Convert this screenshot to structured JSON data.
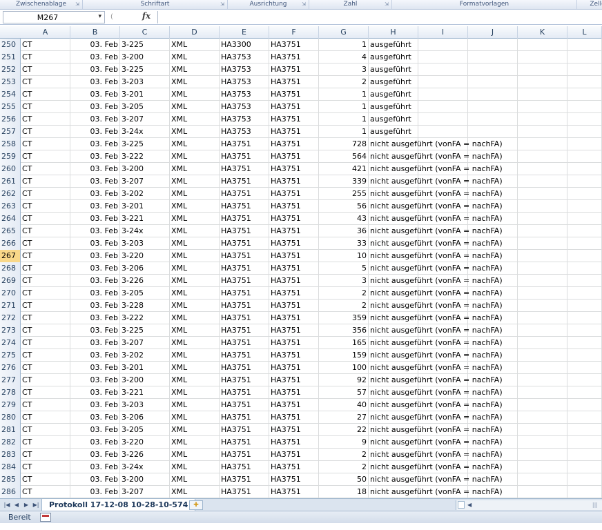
{
  "ribbon_groups": [
    {
      "label": "Zwischenablage",
      "launcher": true
    },
    {
      "label": "Schriftart",
      "launcher": true
    },
    {
      "label": "Ausrichtung",
      "launcher": true
    },
    {
      "label": "Zahl",
      "launcher": true
    },
    {
      "label": "Formatvorlagen",
      "launcher": false
    },
    {
      "label": "Zelle",
      "launcher": false
    }
  ],
  "formula_bar": {
    "name_box": "M267",
    "fx_label": "fx",
    "formula_value": ""
  },
  "columns": [
    "A",
    "B",
    "C",
    "D",
    "E",
    "F",
    "G",
    "H",
    "I",
    "J",
    "K",
    "L"
  ],
  "active_row": "267",
  "rows": [
    [
      "250",
      "CT",
      "03. Feb",
      "3-225",
      "XML",
      "HA3300",
      "HA3751",
      "1",
      "ausgeführt"
    ],
    [
      "251",
      "CT",
      "03. Feb",
      "3-200",
      "XML",
      "HA3753",
      "HA3751",
      "4",
      "ausgeführt"
    ],
    [
      "252",
      "CT",
      "03. Feb",
      "3-225",
      "XML",
      "HA3753",
      "HA3751",
      "3",
      "ausgeführt"
    ],
    [
      "253",
      "CT",
      "03. Feb",
      "3-203",
      "XML",
      "HA3753",
      "HA3751",
      "2",
      "ausgeführt"
    ],
    [
      "254",
      "CT",
      "03. Feb",
      "3-201",
      "XML",
      "HA3753",
      "HA3751",
      "1",
      "ausgeführt"
    ],
    [
      "255",
      "CT",
      "03. Feb",
      "3-205",
      "XML",
      "HA3753",
      "HA3751",
      "1",
      "ausgeführt"
    ],
    [
      "256",
      "CT",
      "03. Feb",
      "3-207",
      "XML",
      "HA3753",
      "HA3751",
      "1",
      "ausgeführt"
    ],
    [
      "257",
      "CT",
      "03. Feb",
      "3-24x",
      "XML",
      "HA3753",
      "HA3751",
      "1",
      "ausgeführt"
    ],
    [
      "258",
      "CT",
      "03. Feb",
      "3-225",
      "XML",
      "HA3751",
      "HA3751",
      "728",
      "nicht ausgeführt (vonFA = nachFA)"
    ],
    [
      "259",
      "CT",
      "03. Feb",
      "3-222",
      "XML",
      "HA3751",
      "HA3751",
      "564",
      "nicht ausgeführt (vonFA = nachFA)"
    ],
    [
      "260",
      "CT",
      "03. Feb",
      "3-200",
      "XML",
      "HA3751",
      "HA3751",
      "421",
      "nicht ausgeführt (vonFA = nachFA)"
    ],
    [
      "261",
      "CT",
      "03. Feb",
      "3-207",
      "XML",
      "HA3751",
      "HA3751",
      "339",
      "nicht ausgeführt (vonFA = nachFA)"
    ],
    [
      "262",
      "CT",
      "03. Feb",
      "3-202",
      "XML",
      "HA3751",
      "HA3751",
      "255",
      "nicht ausgeführt (vonFA = nachFA)"
    ],
    [
      "263",
      "CT",
      "03. Feb",
      "3-201",
      "XML",
      "HA3751",
      "HA3751",
      "56",
      "nicht ausgeführt (vonFA = nachFA)"
    ],
    [
      "264",
      "CT",
      "03. Feb",
      "3-221",
      "XML",
      "HA3751",
      "HA3751",
      "43",
      "nicht ausgeführt (vonFA = nachFA)"
    ],
    [
      "265",
      "CT",
      "03. Feb",
      "3-24x",
      "XML",
      "HA3751",
      "HA3751",
      "36",
      "nicht ausgeführt (vonFA = nachFA)"
    ],
    [
      "266",
      "CT",
      "03. Feb",
      "3-203",
      "XML",
      "HA3751",
      "HA3751",
      "33",
      "nicht ausgeführt (vonFA = nachFA)"
    ],
    [
      "267",
      "CT",
      "03. Feb",
      "3-220",
      "XML",
      "HA3751",
      "HA3751",
      "10",
      "nicht ausgeführt (vonFA = nachFA)"
    ],
    [
      "268",
      "CT",
      "03. Feb",
      "3-206",
      "XML",
      "HA3751",
      "HA3751",
      "5",
      "nicht ausgeführt (vonFA = nachFA)"
    ],
    [
      "269",
      "CT",
      "03. Feb",
      "3-226",
      "XML",
      "HA3751",
      "HA3751",
      "3",
      "nicht ausgeführt (vonFA = nachFA)"
    ],
    [
      "270",
      "CT",
      "03. Feb",
      "3-205",
      "XML",
      "HA3751",
      "HA3751",
      "2",
      "nicht ausgeführt (vonFA = nachFA)"
    ],
    [
      "271",
      "CT",
      "03. Feb",
      "3-228",
      "XML",
      "HA3751",
      "HA3751",
      "2",
      "nicht ausgeführt (vonFA = nachFA)"
    ],
    [
      "272",
      "CT",
      "03. Feb",
      "3-222",
      "XML",
      "HA3751",
      "HA3751",
      "359",
      "nicht ausgeführt (vonFA = nachFA)"
    ],
    [
      "273",
      "CT",
      "03. Feb",
      "3-225",
      "XML",
      "HA3751",
      "HA3751",
      "356",
      "nicht ausgeführt (vonFA = nachFA)"
    ],
    [
      "274",
      "CT",
      "03. Feb",
      "3-207",
      "XML",
      "HA3751",
      "HA3751",
      "165",
      "nicht ausgeführt (vonFA = nachFA)"
    ],
    [
      "275",
      "CT",
      "03. Feb",
      "3-202",
      "XML",
      "HA3751",
      "HA3751",
      "159",
      "nicht ausgeführt (vonFA = nachFA)"
    ],
    [
      "276",
      "CT",
      "03. Feb",
      "3-201",
      "XML",
      "HA3751",
      "HA3751",
      "100",
      "nicht ausgeführt (vonFA = nachFA)"
    ],
    [
      "277",
      "CT",
      "03. Feb",
      "3-200",
      "XML",
      "HA3751",
      "HA3751",
      "92",
      "nicht ausgeführt (vonFA = nachFA)"
    ],
    [
      "278",
      "CT",
      "03. Feb",
      "3-221",
      "XML",
      "HA3751",
      "HA3751",
      "57",
      "nicht ausgeführt (vonFA = nachFA)"
    ],
    [
      "279",
      "CT",
      "03. Feb",
      "3-203",
      "XML",
      "HA3751",
      "HA3751",
      "40",
      "nicht ausgeführt (vonFA = nachFA)"
    ],
    [
      "280",
      "CT",
      "03. Feb",
      "3-206",
      "XML",
      "HA3751",
      "HA3751",
      "27",
      "nicht ausgeführt (vonFA = nachFA)"
    ],
    [
      "281",
      "CT",
      "03. Feb",
      "3-205",
      "XML",
      "HA3751",
      "HA3751",
      "22",
      "nicht ausgeführt (vonFA = nachFA)"
    ],
    [
      "282",
      "CT",
      "03. Feb",
      "3-220",
      "XML",
      "HA3751",
      "HA3751",
      "9",
      "nicht ausgeführt (vonFA = nachFA)"
    ],
    [
      "283",
      "CT",
      "03. Feb",
      "3-226",
      "XML",
      "HA3751",
      "HA3751",
      "2",
      "nicht ausgeführt (vonFA = nachFA)"
    ],
    [
      "284",
      "CT",
      "03. Feb",
      "3-24x",
      "XML",
      "HA3751",
      "HA3751",
      "2",
      "nicht ausgeführt (vonFA = nachFA)"
    ],
    [
      "285",
      "CT",
      "03. Feb",
      "3-200",
      "XML",
      "HA3751",
      "HA3751",
      "50",
      "nicht ausgeführt (vonFA = nachFA)"
    ],
    [
      "286",
      "CT",
      "03. Feb",
      "3-207",
      "XML",
      "HA3751",
      "HA3751",
      "18",
      "nicht ausgeführt (vonFA = nachFA)"
    ]
  ],
  "sheet_tabs": {
    "active_tab": "Protokoll 17-12-08 10-28-10-574",
    "nav_icons": [
      "first-sheet-icon",
      "prev-sheet-icon",
      "next-sheet-icon",
      "last-sheet-icon"
    ],
    "new_sheet_icon": "insert-sheet-icon"
  },
  "status_bar": {
    "mode": "Bereit",
    "macro_icon": "record-macro-icon"
  },
  "colors": {
    "active_row_header": "#f9d889",
    "ribbon_text": "#3e5479",
    "header_text": "#27415f"
  }
}
